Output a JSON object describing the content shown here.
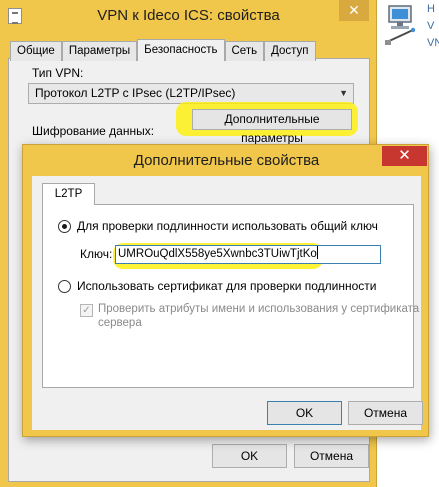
{
  "bg_window": {
    "title": "VPN к Ideco ICS: свойства",
    "close_glyph": "✕",
    "tabs": [
      "Общие",
      "Параметры",
      "Безопасность",
      "Сеть",
      "Доступ"
    ],
    "active_tab": "Безопасность",
    "vpn_type_label": "Тип VPN:",
    "vpn_type_value": "Протокол L2TP с IPsec (L2TP/IPsec)",
    "advanced_button": "Дополнительные параметры",
    "encryption_label": "Шифрование данных:",
    "ok_button": "OK",
    "cancel_button": "Отмена"
  },
  "right_edge": {
    "line1": "Н",
    "line2": "V",
    "line3": "VN"
  },
  "dialog": {
    "title": "Дополнительные свойства",
    "close_glyph": "✕",
    "tab": "L2TP",
    "option_psk": {
      "label": "Для проверки подлинности использовать общий ключ",
      "selected": true
    },
    "key_label": "Ключ:",
    "key_value": "UMROuQdlX558ye5Xwnbc3TUiwTjtKo",
    "option_cert": {
      "label": "Использовать сертификат для проверки подлинности",
      "selected": false
    },
    "verify_checkbox": {
      "line1": "Проверить атрибуты имени и использования у сертификата",
      "line2": "сервера",
      "checked": true,
      "disabled": true
    },
    "ok_button": "OK",
    "cancel_button": "Отмена"
  },
  "colors": {
    "window_frame": "#f0c64b",
    "close_button": "#c7372f",
    "highlight": "#fff000",
    "focus_border": "#3c7fb1"
  }
}
